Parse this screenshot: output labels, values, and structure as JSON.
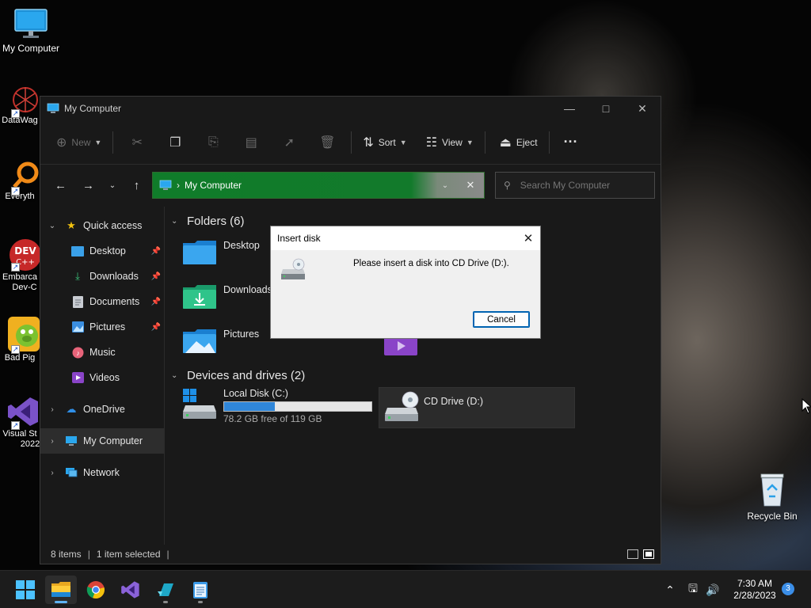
{
  "desktop": {
    "icons": {
      "my_computer": "My Computer",
      "datawag": "DataWag",
      "everything": "Everyth",
      "embarcadero_1": "Embarca",
      "embarcadero_2": "Dev-C",
      "bad_piggies": "Bad Pig",
      "visual_studio_1": "Visual St",
      "visual_studio_2": "2022",
      "recycle_bin": "Recycle Bin"
    }
  },
  "explorer": {
    "title": "My Computer",
    "toolbar": {
      "new_label": "New",
      "sort_label": "Sort",
      "view_label": "View",
      "eject_label": "Eject"
    },
    "address": {
      "crumb": "My Computer"
    },
    "search": {
      "placeholder": "Search My Computer"
    },
    "sidebar": {
      "quick_access": "Quick access",
      "items": [
        "Desktop",
        "Downloads",
        "Documents",
        "Pictures",
        "Music",
        "Videos"
      ],
      "onedrive": "OneDrive",
      "my_computer": "My Computer",
      "network": "Network"
    },
    "folders": {
      "header": "Folders (6)",
      "items": [
        "Desktop",
        "Downloads",
        "Pictures"
      ]
    },
    "drives": {
      "header": "Devices and drives (2)",
      "local": {
        "name": "Local Disk (C:)",
        "free_text": "78.2 GB free of 119 GB",
        "used_fraction": 0.343
      },
      "cd": {
        "name": "CD Drive (D:)"
      }
    },
    "status": {
      "items": "8 items",
      "selected": "1 item selected"
    }
  },
  "dialog": {
    "title": "Insert disk",
    "message": "Please insert a disk into CD Drive (D:).",
    "cancel_label": "Cancel"
  },
  "taskbar": {
    "time": "7:30 AM",
    "date": "2/28/2023",
    "notifications": "3"
  },
  "colors": {
    "accent": "#107c2a",
    "meter": "#2f86d9",
    "dialog_button_border": "#0063b1"
  }
}
